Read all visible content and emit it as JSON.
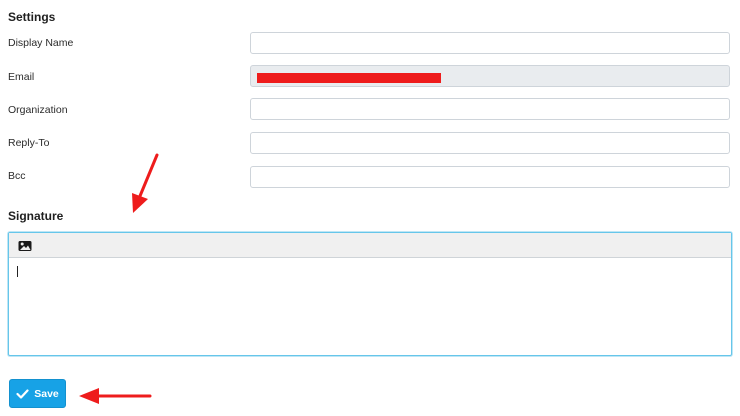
{
  "settings": {
    "heading": "Settings",
    "fields": [
      {
        "label": "Display Name",
        "value": ""
      },
      {
        "label": "Email",
        "value": "",
        "redacted": true
      },
      {
        "label": "Organization",
        "value": ""
      },
      {
        "label": "Reply-To",
        "value": ""
      },
      {
        "label": "Bcc",
        "value": ""
      }
    ]
  },
  "signature": {
    "heading": "Signature",
    "toolbar_icon": "image-icon",
    "content": ""
  },
  "save_button": {
    "label": "Save",
    "icon": "checkmark-icon"
  },
  "colors": {
    "accent": "#17a2e6",
    "annotation": "#ee1c1c",
    "editor_border": "#66c6ea",
    "readonly_bg": "#e9ecef"
  }
}
